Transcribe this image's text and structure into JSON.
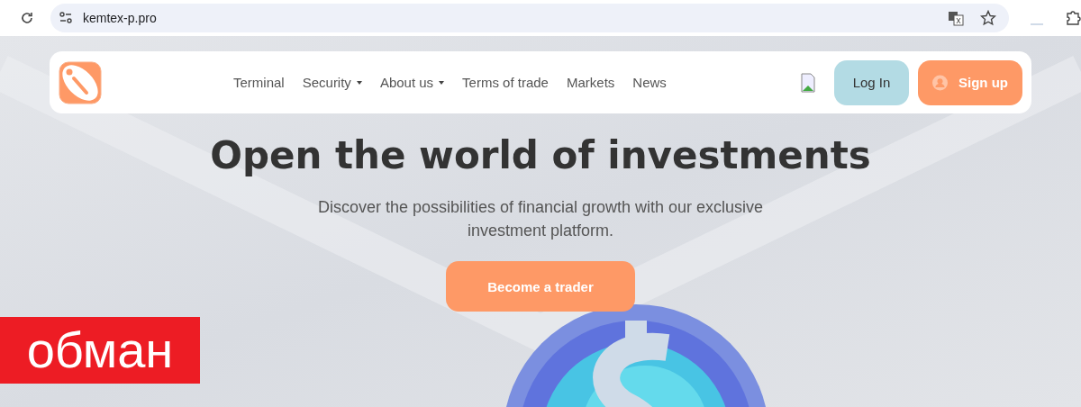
{
  "browser": {
    "url": "kemtex-p.pro"
  },
  "nav": {
    "links": [
      {
        "label": "Terminal",
        "dropdown": false
      },
      {
        "label": "Security",
        "dropdown": true
      },
      {
        "label": "About us",
        "dropdown": true
      },
      {
        "label": "Terms of trade",
        "dropdown": false
      },
      {
        "label": "Markets",
        "dropdown": false
      },
      {
        "label": "News",
        "dropdown": false
      }
    ],
    "login": "Log In",
    "signup": "Sign up"
  },
  "hero": {
    "title": "Open the world of investments",
    "subtitle": "Discover the possibilities of financial growth with our exclusive investment platform.",
    "cta": "Become a trader"
  },
  "stamp": "обман"
}
